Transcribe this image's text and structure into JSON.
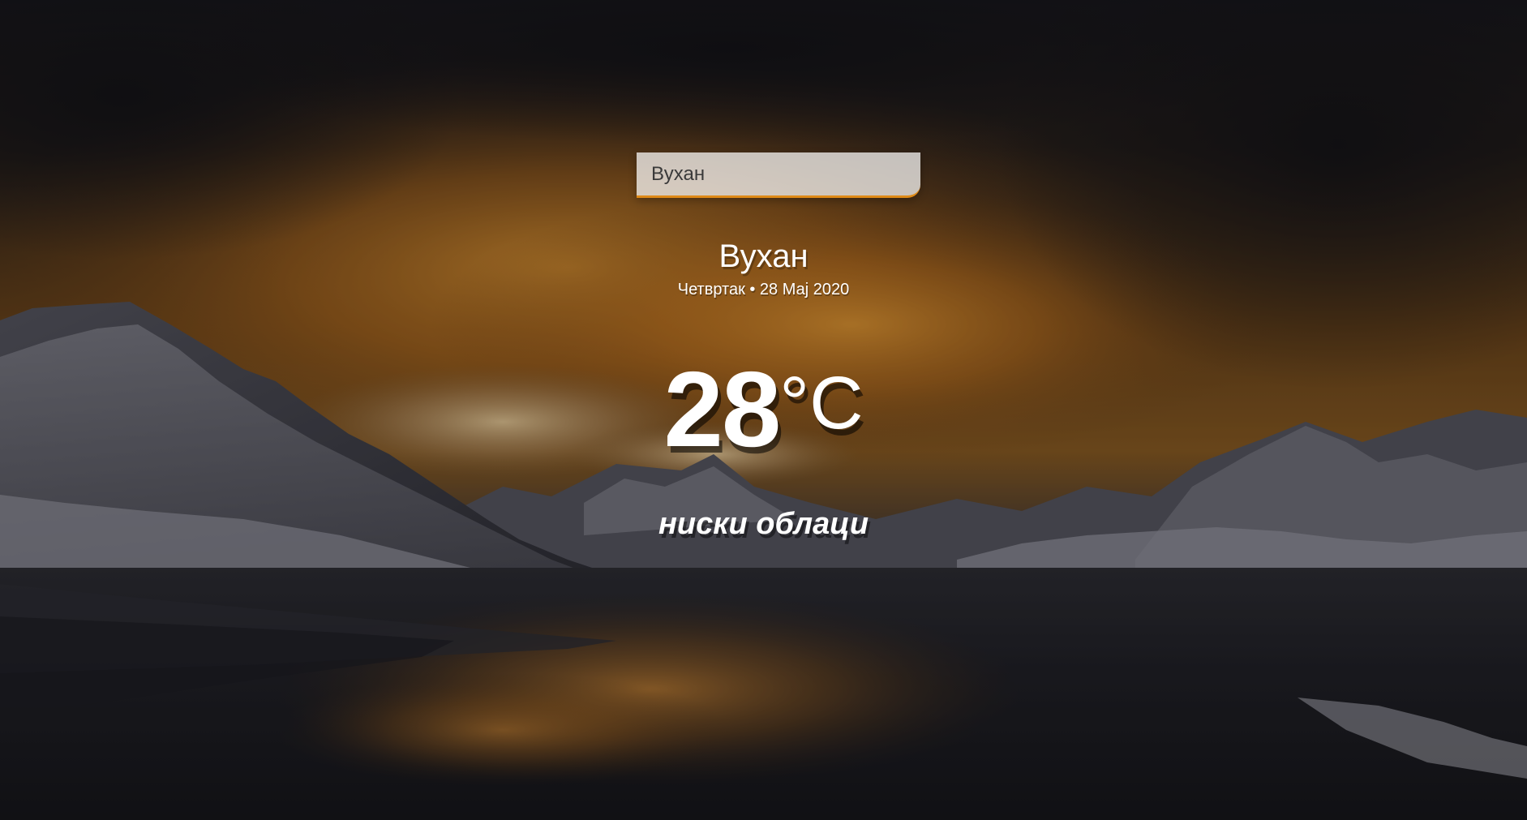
{
  "search": {
    "value": "Вухан",
    "accent_color": "#df8a17"
  },
  "location": {
    "name": "Вухан",
    "date": "Четвртак • 28 Мај 2020"
  },
  "weather": {
    "temperature": "28",
    "unit": "°C",
    "description": "ниски облаци"
  },
  "background": {
    "description_icon": "sunset-mountain-lake-photo",
    "sky_glow_color": "#e08a1a",
    "overlay_color": "#101014"
  }
}
